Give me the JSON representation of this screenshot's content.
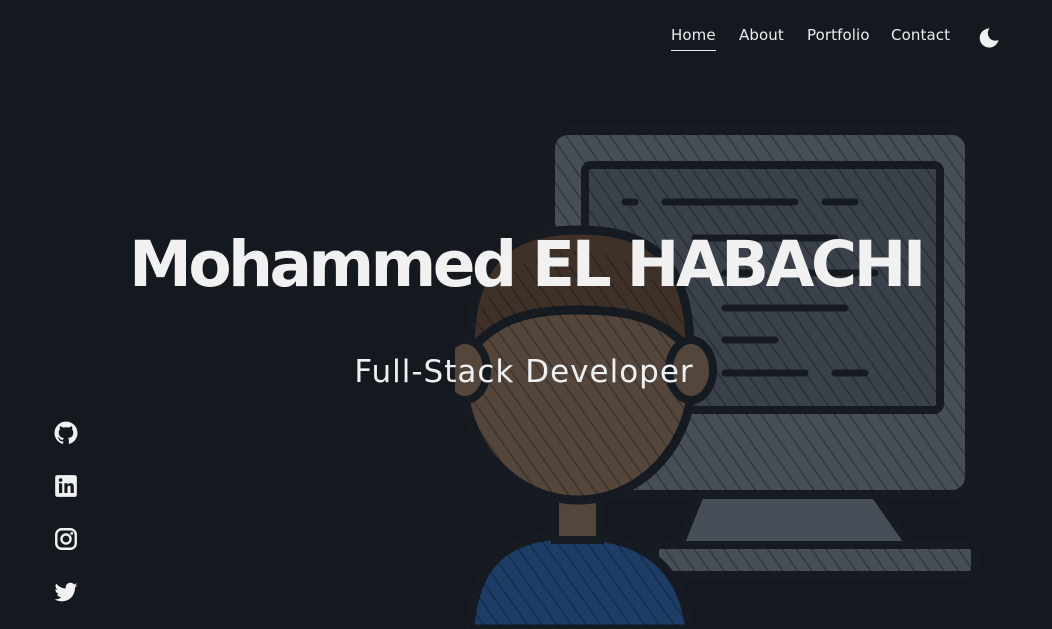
{
  "nav": {
    "items": [
      {
        "label": "Home",
        "active": true
      },
      {
        "label": "About",
        "active": false
      },
      {
        "label": "Portfolio",
        "active": false
      },
      {
        "label": "Contact",
        "active": false
      }
    ],
    "theme_toggle_icon": "moon-icon"
  },
  "hero": {
    "name": "Mohammed EL HABACHI",
    "role": "Full-Stack Developer",
    "illustration": "developer-at-computer-illustration"
  },
  "social": {
    "icons": [
      "github-icon",
      "linkedin-icon",
      "instagram-icon",
      "twitter-icon"
    ]
  },
  "colors": {
    "background": "#141920",
    "text": "#f1f1f1",
    "shirt": "#2a6fc9",
    "skin": "#b08560",
    "monitor": "#8a94a3"
  }
}
